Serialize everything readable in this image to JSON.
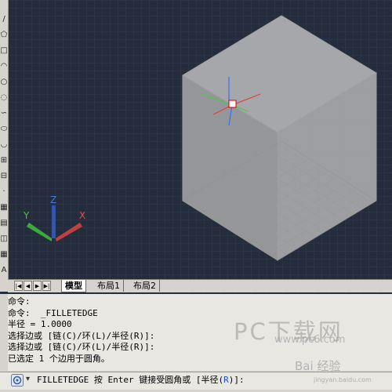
{
  "viewport": {
    "background": "#252d3c",
    "grid_color": "#2f3a4c",
    "cube_color": "#b7b7b7"
  },
  "ucs_icon": {
    "x_label": "X",
    "y_label": "Y",
    "z_label": "Z"
  },
  "tabs": {
    "nav_first": "|◀",
    "nav_prev": "◀",
    "nav_next": "▶",
    "nav_last": "▶|",
    "items": [
      {
        "label": "模型",
        "active": true
      },
      {
        "label": "布局1",
        "active": false
      },
      {
        "label": "布局2",
        "active": false
      }
    ]
  },
  "left_toolbar": {
    "icons": [
      "line-icon",
      "polygon-icon",
      "rectangle-icon",
      "arc-icon",
      "circle-icon",
      "revcloud-icon",
      "spline-icon",
      "ellipse-icon",
      "ellipse-arc-icon",
      "insert-block-icon",
      "make-block-icon",
      "point-icon",
      "hatch-icon",
      "gradient-icon",
      "region-icon",
      "table-icon",
      "text-icon"
    ],
    "glyphs": [
      "/",
      "⬠",
      "□",
      "◠",
      "○",
      "◌",
      "∽",
      "⬭",
      "◡",
      "⊞",
      "⊟",
      "·",
      "▦",
      "▤",
      "◫",
      "▦",
      "A"
    ]
  },
  "command_history": [
    "命令:",
    "命令:  _FILLETEDGE",
    "半径 = 1.0000",
    "选择边或 [链(C)/环(L)/半径(R)]:",
    "选择边或 [链(C)/环(L)/半径(R)]:",
    "已选定 1 个边用于圆角。"
  ],
  "command_prompt": {
    "prefix": "FILLETEDGE 按 Enter 键接受圆角或 [半径(",
    "option": "R",
    "suffix": ")]:"
  },
  "watermark": {
    "main": "PC下载网",
    "sub": "www.pc6.com",
    "brand": "Bai 经验",
    "url": "jingyan.baidu.com"
  }
}
